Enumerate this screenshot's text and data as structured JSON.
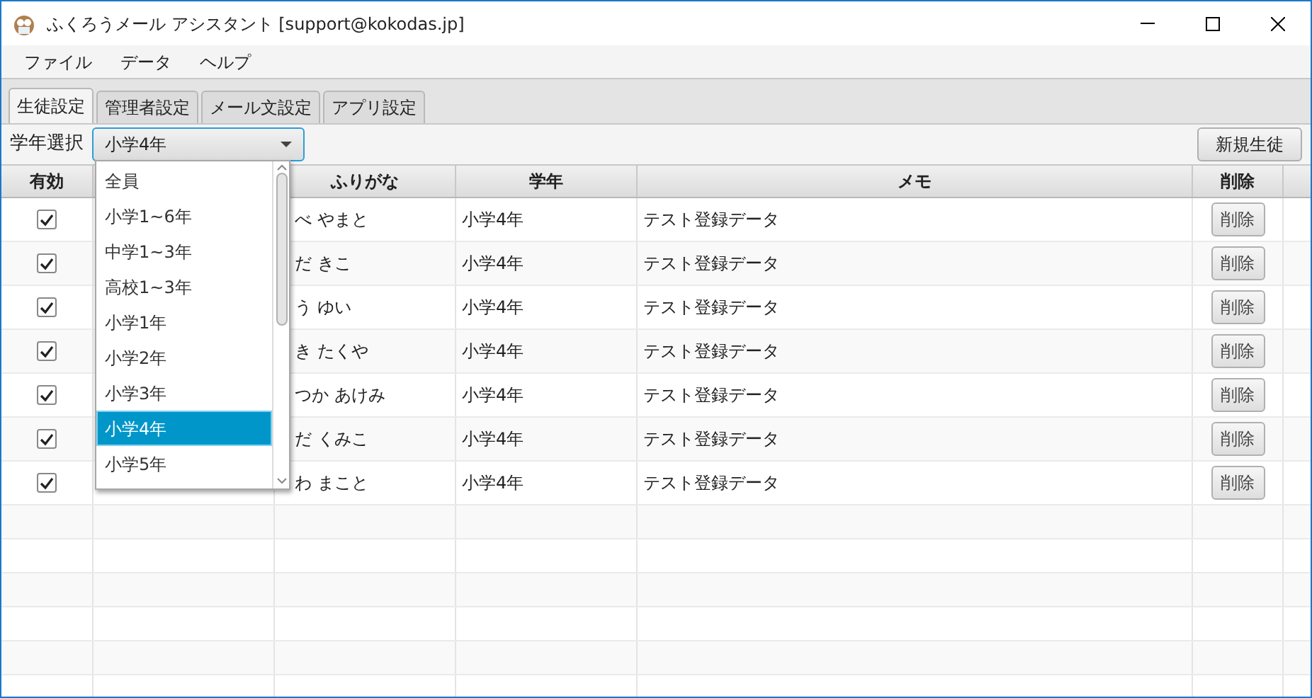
{
  "window": {
    "title": "ふくろうメール アシスタント [support@kokodas.jp]"
  },
  "menu": [
    "ファイル",
    "データ",
    "ヘルプ"
  ],
  "tabs": [
    {
      "label": "生徒設定",
      "selected": true
    },
    {
      "label": "管理者設定",
      "selected": false
    },
    {
      "label": "メール文設定",
      "selected": false
    },
    {
      "label": "アプリ設定",
      "selected": false
    }
  ],
  "grade_select": {
    "label": "学年選択",
    "value": "小学4年",
    "expanded": true,
    "options": [
      {
        "label": "全員",
        "selected": false
      },
      {
        "label": "小学1~6年",
        "selected": false
      },
      {
        "label": "中学1~3年",
        "selected": false
      },
      {
        "label": "高校1~3年",
        "selected": false
      },
      {
        "label": "小学1年",
        "selected": false
      },
      {
        "label": "小学2年",
        "selected": false
      },
      {
        "label": "小学3年",
        "selected": false
      },
      {
        "label": "小学4年",
        "selected": true
      },
      {
        "label": "小学5年",
        "selected": false
      }
    ]
  },
  "new_student_button": "新規生徒",
  "table": {
    "columns": [
      "有効",
      "",
      "ふりがな",
      "学年",
      "メモ",
      "削除"
    ],
    "rows": [
      {
        "enabled": true,
        "furigana": "べ やまと",
        "grade": "小学4年",
        "memo": "テスト登録データ",
        "delete": "削除"
      },
      {
        "enabled": true,
        "furigana": "だ きこ",
        "grade": "小学4年",
        "memo": "テスト登録データ",
        "delete": "削除"
      },
      {
        "enabled": true,
        "furigana": "う ゆい",
        "grade": "小学4年",
        "memo": "テスト登録データ",
        "delete": "削除"
      },
      {
        "enabled": true,
        "furigana": "き たくや",
        "grade": "小学4年",
        "memo": "テスト登録データ",
        "delete": "削除"
      },
      {
        "enabled": true,
        "furigana": "つか あけみ",
        "grade": "小学4年",
        "memo": "テスト登録データ",
        "delete": "削除"
      },
      {
        "enabled": true,
        "furigana": "だ くみこ",
        "grade": "小学4年",
        "memo": "テスト登録データ",
        "delete": "削除"
      },
      {
        "enabled": true,
        "furigana": "わ まこと",
        "grade": "小学4年",
        "memo": "テスト登録データ",
        "delete": "削除"
      }
    ]
  }
}
